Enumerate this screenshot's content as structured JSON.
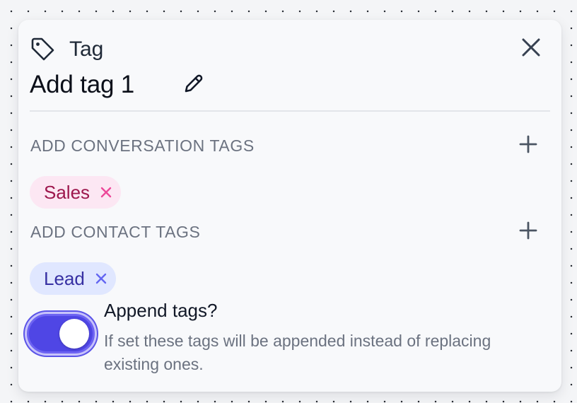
{
  "panel": {
    "type_label": "Tag",
    "node_name": "Add tag 1",
    "icons": {
      "type": "tag-icon",
      "close": "close-icon",
      "edit": "pencil-icon",
      "add": "plus-icon",
      "remove": "x-icon"
    }
  },
  "conversation_tags": {
    "label": "ADD CONVERSATION TAGS",
    "tags": [
      {
        "label": "Sales",
        "color": "#fce7f3",
        "text_color": "#9d174d",
        "remove_color": "#ec4899"
      }
    ]
  },
  "contact_tags": {
    "label": "ADD CONTACT TAGS",
    "tags": [
      {
        "label": "Lead",
        "color": "#e0e7ff",
        "text_color": "#3730a3",
        "remove_color": "#6366f1"
      }
    ]
  },
  "append": {
    "title": "Append tags?",
    "description": "If set these tags will be appended instead of replacing existing ones.",
    "enabled": true,
    "accent": "#4f46e5"
  }
}
